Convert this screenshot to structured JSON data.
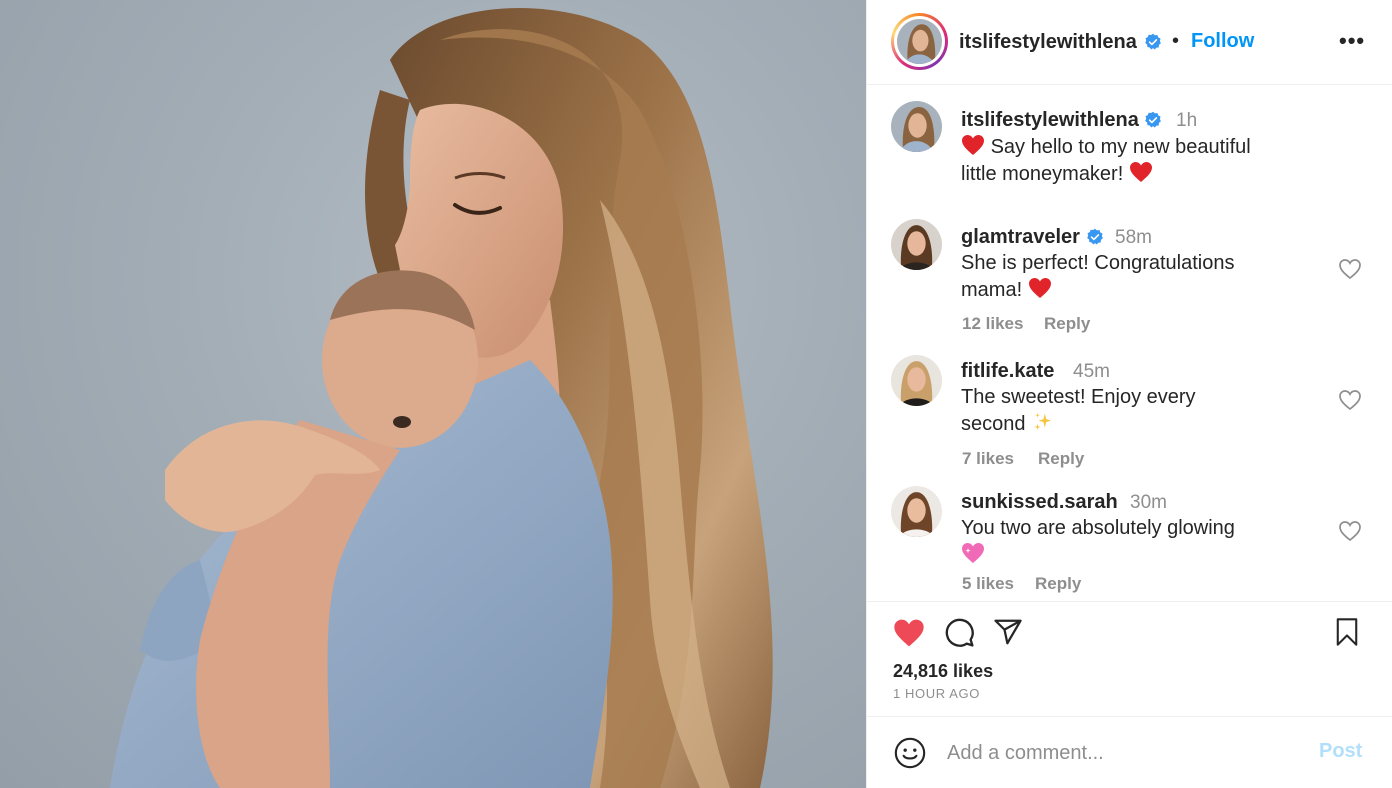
{
  "post": {
    "author": "itslifestylewithlena",
    "separator": "•",
    "follow_label": "Follow",
    "more_label": "•••",
    "caption_time": "1h",
    "caption_line1": "Say hello to my new beautiful",
    "caption_line2": "little moneymaker!",
    "likes": "24,816 likes",
    "time_ago": "1 HOUR AGO"
  },
  "comments": [
    {
      "user": "glamtraveler",
      "verified": true,
      "time": "58m",
      "line1": "She is perfect! Congratulations",
      "line2": "mama!",
      "emoji": "heart",
      "likes": "12 likes",
      "reply": "Reply"
    },
    {
      "user": "fitlife.kate",
      "verified": false,
      "time": "45m",
      "line1": "The sweetest! Enjoy every",
      "line2": "second",
      "emoji": "sparkles",
      "likes": "7 likes",
      "reply": "Reply"
    },
    {
      "user": "sunkissed.sarah",
      "verified": false,
      "time": "30m",
      "line1": "You two are absolutely glowing",
      "line2": "",
      "emoji": "sparkling-heart",
      "likes": "5 likes",
      "reply": "Reply"
    }
  ],
  "composer": {
    "placeholder": "Add a comment...",
    "post_label": "Post"
  },
  "colors": {
    "link_blue": "#0095f6",
    "like_red": "#ed4956",
    "muted": "#8e8e8e",
    "post_disabled": "#b2dffc"
  },
  "icons": [
    "verified-badge-icon",
    "heart-icon",
    "comment-icon",
    "share-icon",
    "bookmark-icon",
    "emoji-icon",
    "more-icon"
  ]
}
